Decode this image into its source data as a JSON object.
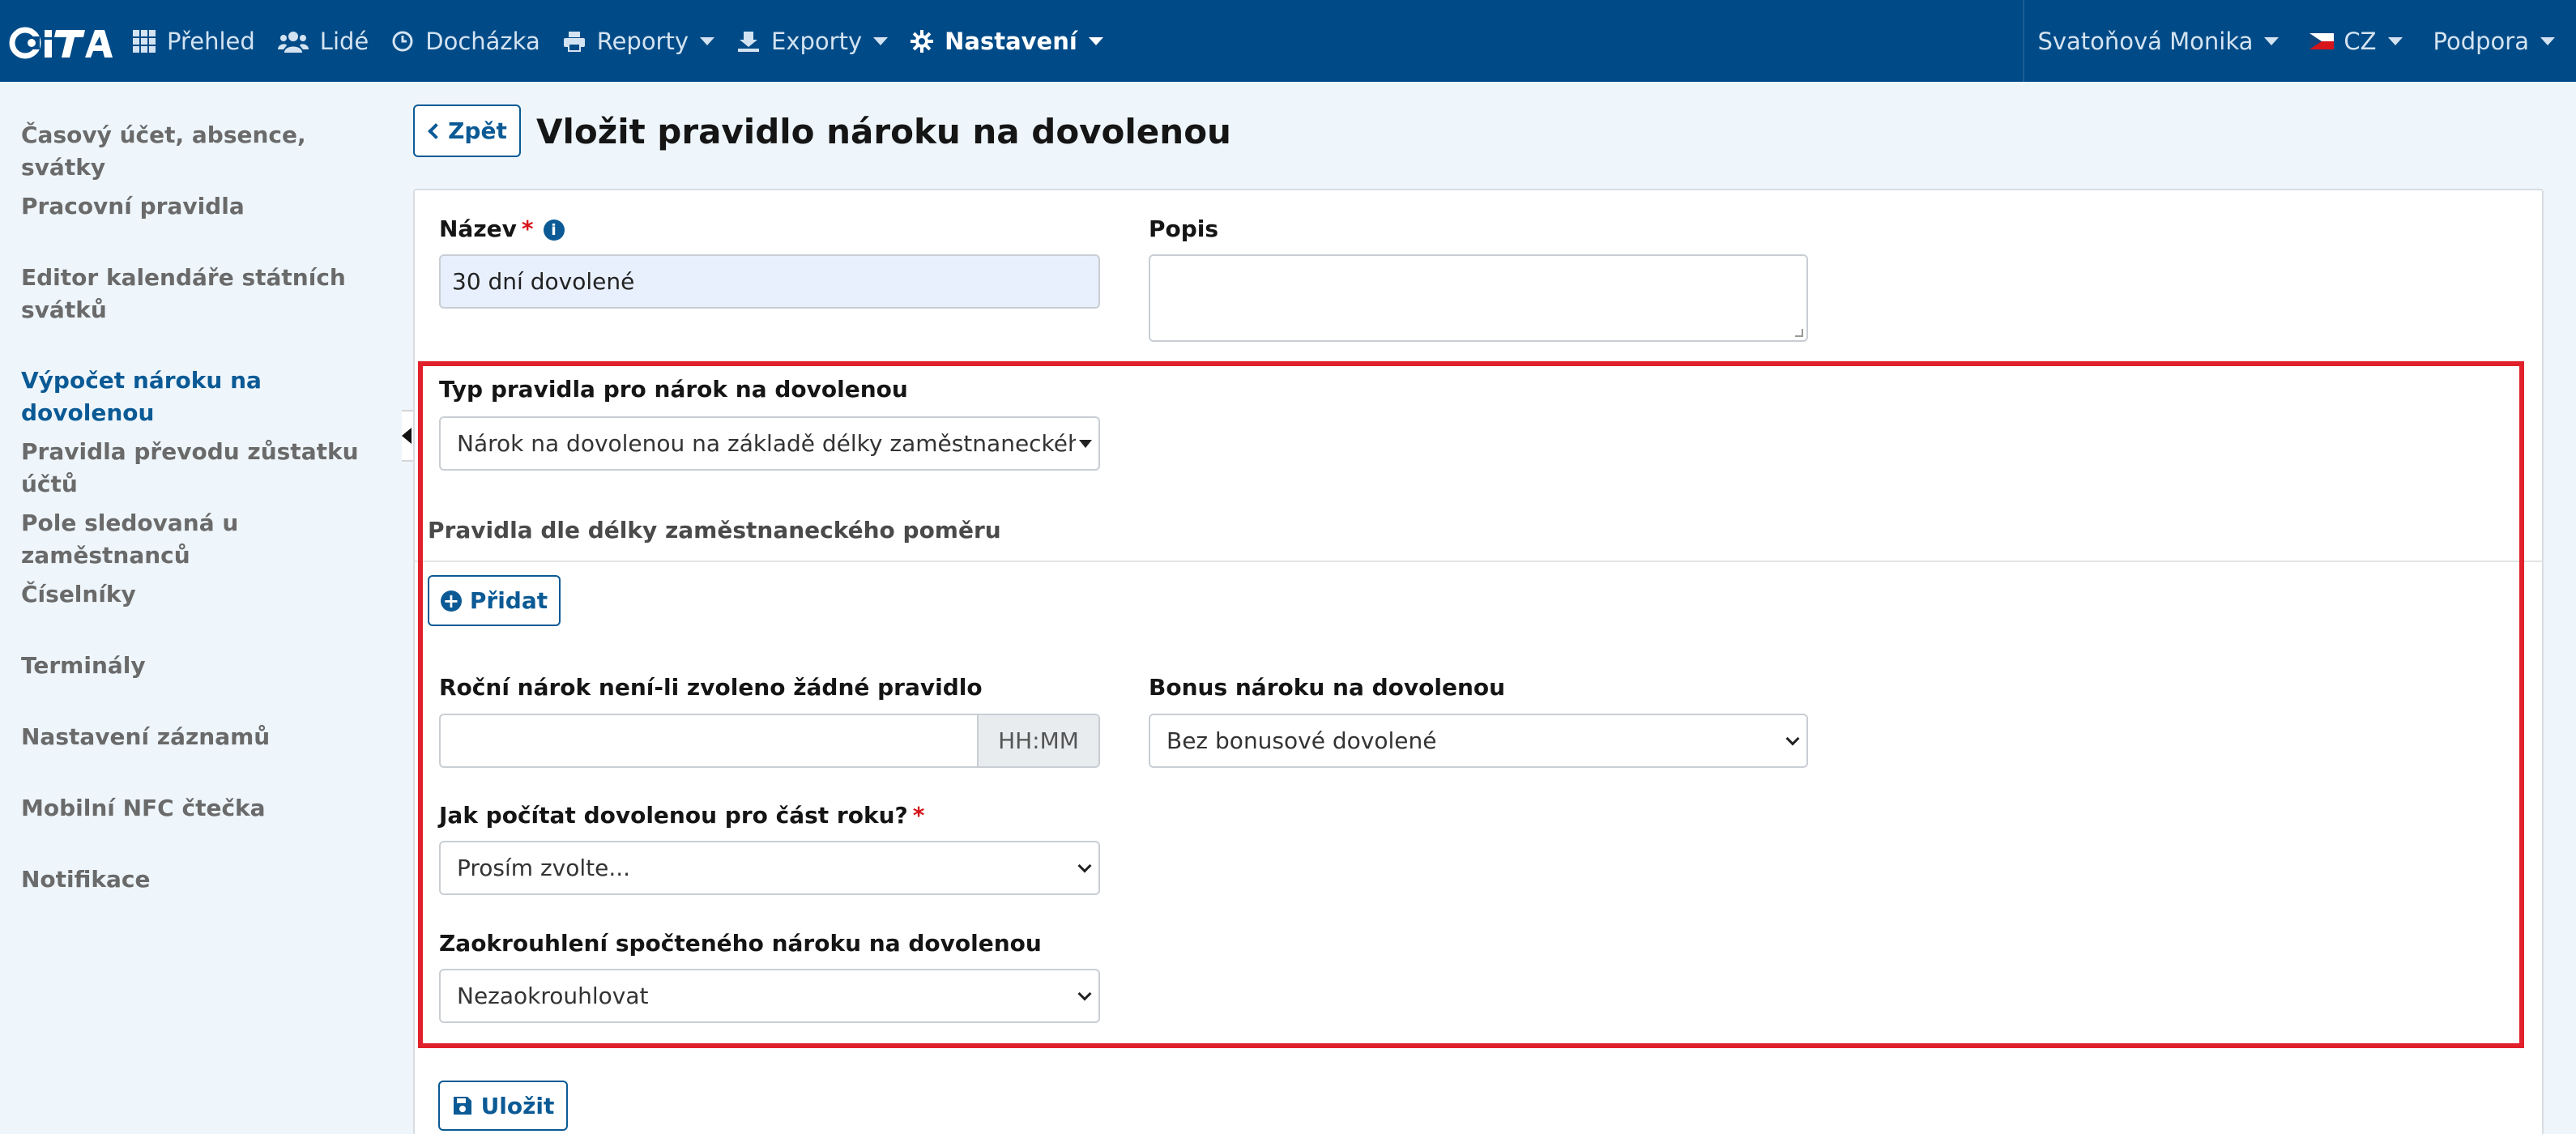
{
  "app": {
    "logo_text": "CITA"
  },
  "nav": {
    "items": [
      {
        "label": "Přehled",
        "icon": "grid-icon"
      },
      {
        "label": "Lidé",
        "icon": "users-icon"
      },
      {
        "label": "Docházka",
        "icon": "clock-icon"
      },
      {
        "label": "Reporty",
        "icon": "print-icon"
      },
      {
        "label": "Exporty",
        "icon": "export-icon"
      },
      {
        "label": "Nastavení",
        "icon": "gear-icon"
      }
    ],
    "user": "Svatoňová Monika",
    "language": "CZ",
    "support": "Podpora"
  },
  "sidebar": {
    "items": [
      {
        "label": "Časový účet, absence, svátky"
      },
      {
        "label": "Pracovní pravidla"
      },
      {
        "label": "Editor kalendáře státních svátků"
      },
      {
        "label": "Výpočet nároku na dovolenou"
      },
      {
        "label": "Pravidla převodu zůstatku účtů"
      },
      {
        "label": "Pole sledovaná u zaměstnanců"
      },
      {
        "label": "Číselníky"
      },
      {
        "label": "Terminály"
      },
      {
        "label": "Nastavení záznamů"
      },
      {
        "label": "Mobilní NFC čtečka"
      },
      {
        "label": "Notifikace"
      }
    ]
  },
  "header": {
    "back_label": "Zpět",
    "title": "Vložit pravidlo nároku na dovolenou"
  },
  "form": {
    "name_label": "Název",
    "name_value": "30 dní dovolené",
    "description_label": "Popis",
    "description_value": "",
    "rule_type_label": "Typ pravidla pro nárok na dovolenou",
    "rule_type_value": "Nárok na dovolenou na základě délky zaměstnaneckého poměru",
    "rules_section_title": "Pravidla dle délky zaměstnaneckého poměru",
    "add_label": "Přidat",
    "annual_label": "Roční nárok není-li zvoleno žádné pravidlo",
    "annual_value": "",
    "annual_addon": "HH:MM",
    "bonus_label": "Bonus nároku na dovolenou",
    "bonus_value": "Bez bonusové dovolené",
    "partial_label": "Jak počítat dovolenou pro část roku?",
    "partial_value": "Prosím zvolte...",
    "rounding_label": "Zaokrouhlení spočteného nároku na dovolenou",
    "rounding_value": "Nezaokrouhlovat",
    "required_mark": "*",
    "save_label": "Uložit"
  },
  "colors": {
    "navbar": "#004b87",
    "accent": "#0b5a95",
    "highlight": "#e0202b",
    "background": "#eef6fc"
  }
}
